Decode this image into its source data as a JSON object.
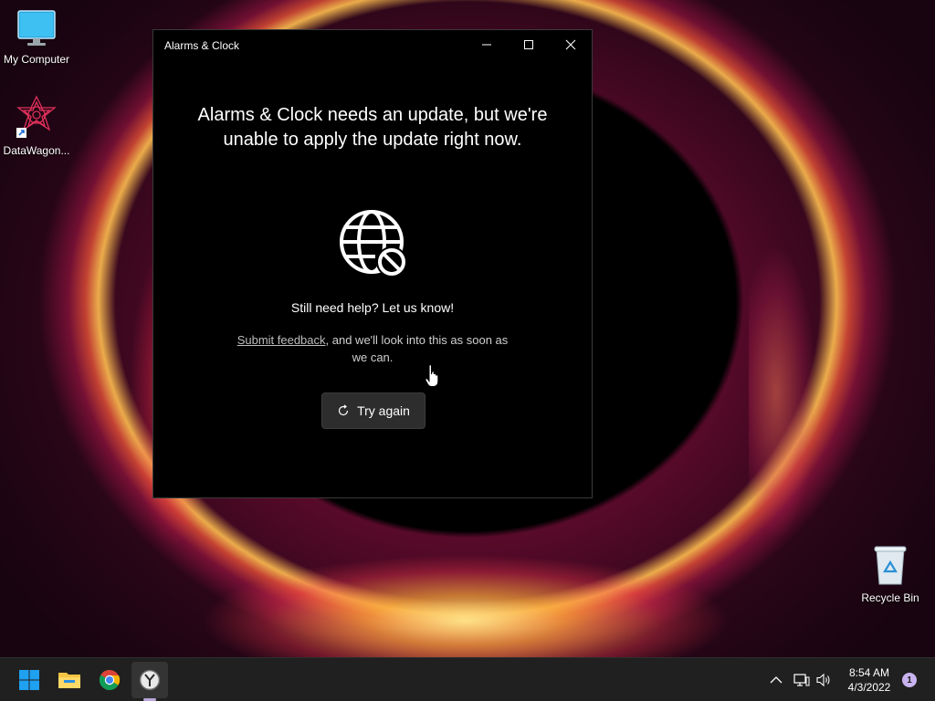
{
  "desktop": {
    "icons": [
      {
        "label": "My Computer"
      },
      {
        "label": "DataWagon..."
      },
      {
        "label": "Recycle Bin"
      }
    ]
  },
  "window": {
    "title": "Alarms & Clock",
    "headline": "Alarms & Clock needs an update, but we're unable to apply the update right now.",
    "help_text": "Still need help? Let us know!",
    "feedback_link": "Submit feedback",
    "feedback_rest": ", and we'll look into this as soon as we can.",
    "try_again_label": "Try again",
    "controls": {
      "minimize": "minimize-icon",
      "maximize": "maximize-icon",
      "close": "close-icon"
    },
    "status_icon": "globe-blocked-icon"
  },
  "taskbar": {
    "apps": [
      {
        "icon": "windows-start-icon"
      },
      {
        "icon": "file-explorer-icon"
      },
      {
        "icon": "chrome-icon"
      },
      {
        "icon": "alarms-clock-icon",
        "active": true
      }
    ],
    "tray": {
      "time": "8:54 AM",
      "date": "4/3/2022",
      "notification_count": "1"
    }
  },
  "colors": {
    "window_bg": "#000000",
    "button_bg": "#2d2d2d",
    "taskbar_bg": "#202020",
    "badge": "#c9b3ee"
  }
}
